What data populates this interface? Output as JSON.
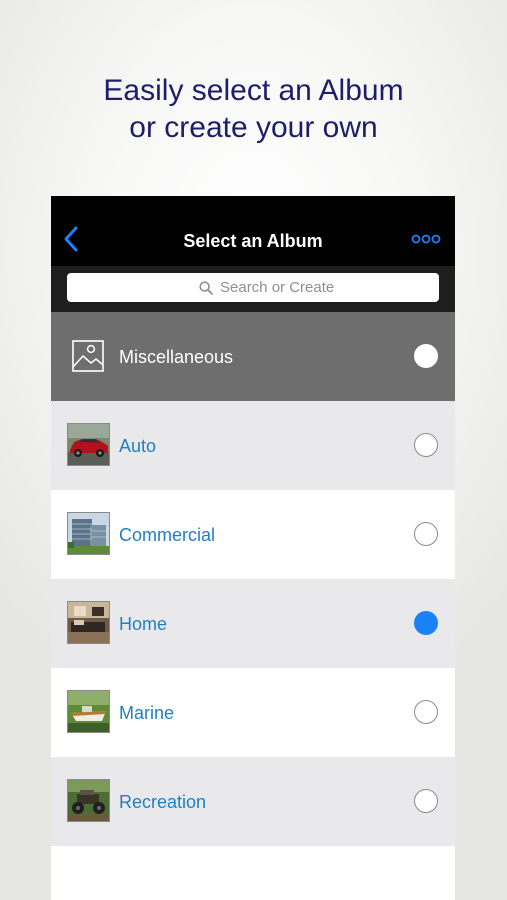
{
  "promo": {
    "line1": "Easily select an Album",
    "line2": "or create your own"
  },
  "navbar": {
    "title": "Select an Album",
    "back_icon": "chevron-left-icon",
    "more_icon": "more-icon"
  },
  "search": {
    "placeholder": "Search or Create"
  },
  "albums": [
    {
      "label": "Miscellaneous",
      "icon": "image-icon",
      "selected": false
    },
    {
      "label": "Auto",
      "icon": "car-thumbnail",
      "selected": false
    },
    {
      "label": "Commercial",
      "icon": "building-thumbnail",
      "selected": false
    },
    {
      "label": "Home",
      "icon": "home-interior-thumbnail",
      "selected": true
    },
    {
      "label": "Marine",
      "icon": "boat-thumbnail",
      "selected": false
    },
    {
      "label": "Recreation",
      "icon": "atv-thumbnail",
      "selected": false
    }
  ],
  "colors": {
    "accent": "#1a82f7",
    "label_blue": "#1f7fc5",
    "promo_text": "#1d1d6b"
  }
}
